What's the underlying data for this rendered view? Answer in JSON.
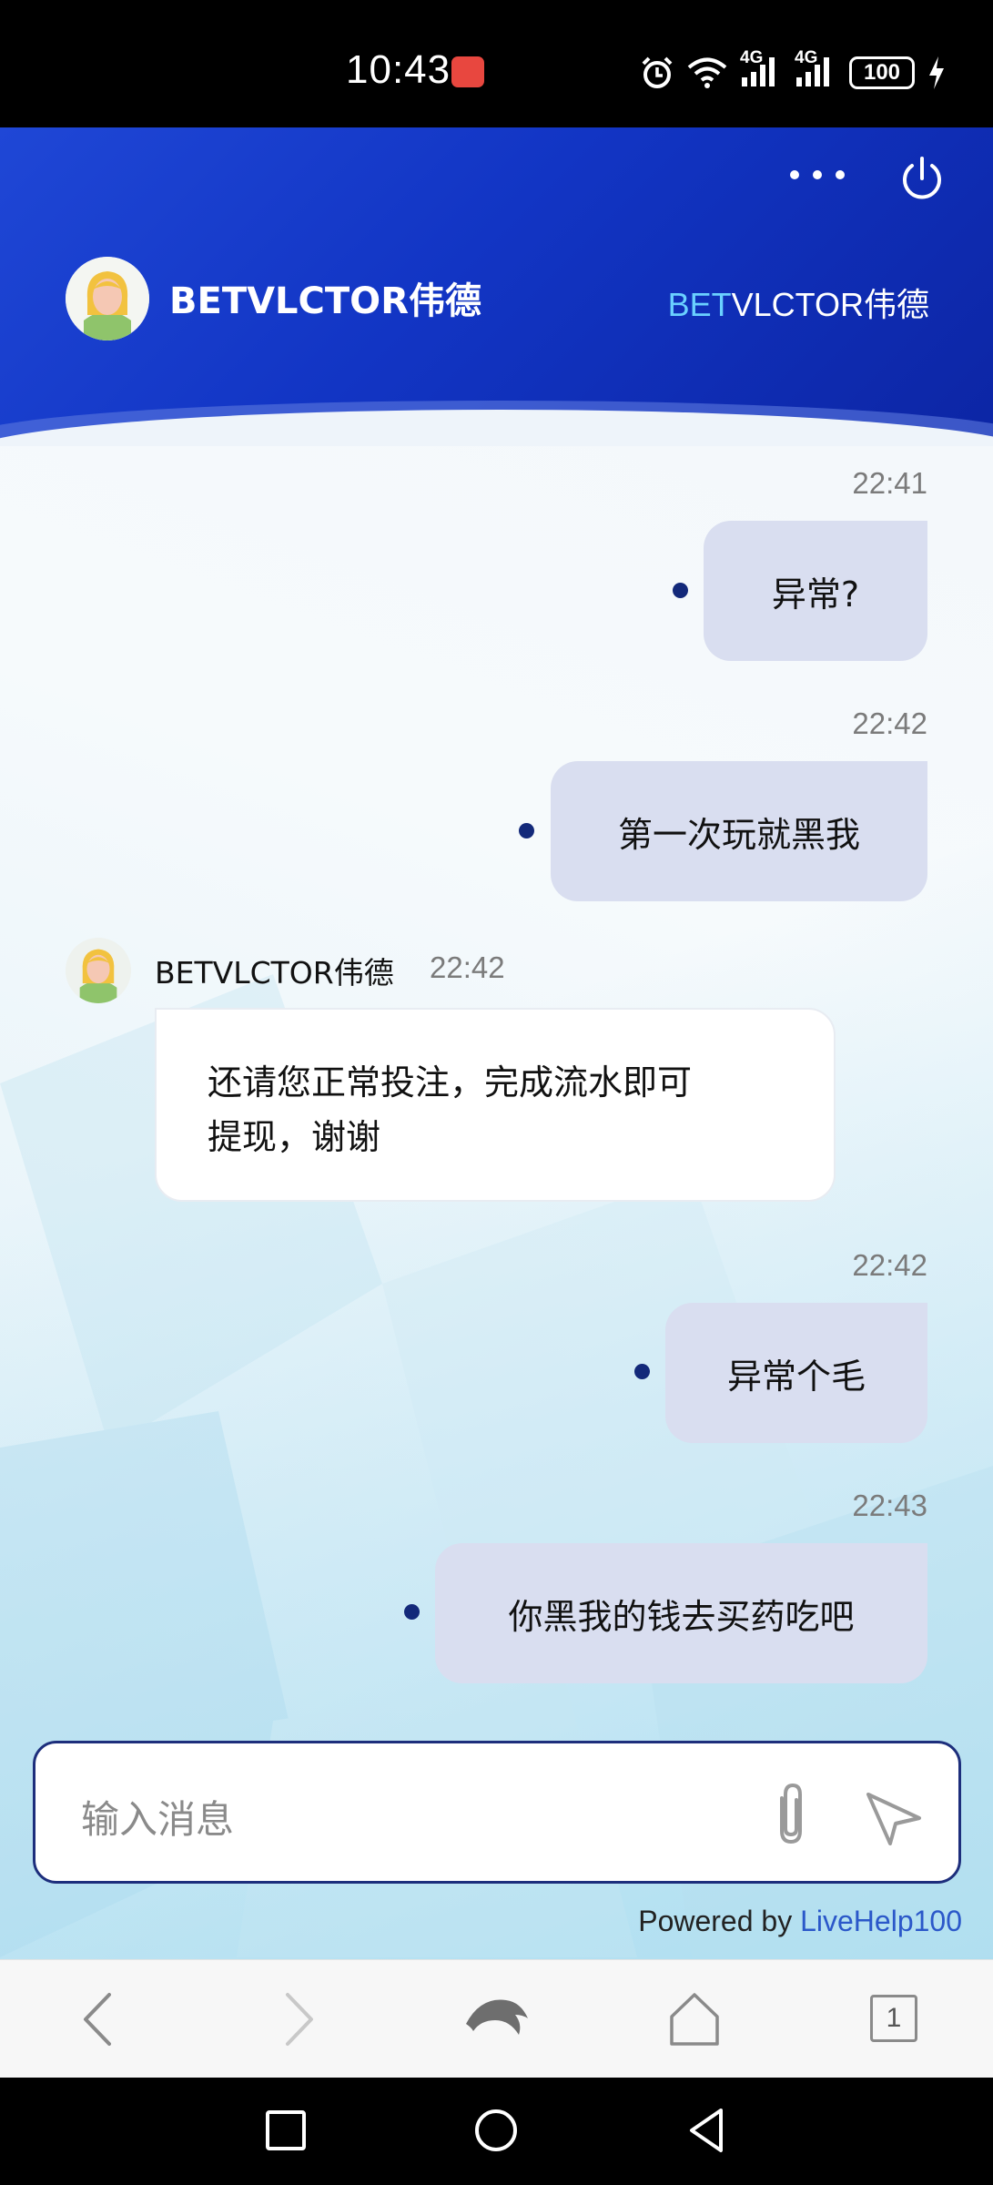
{
  "status_bar": {
    "time": "10:43",
    "network_1": "4G",
    "network_2": "4G",
    "battery": "100",
    "icons": [
      "huawei-app-icon",
      "alarm-icon",
      "wifi-icon",
      "signal-icon",
      "signal-icon",
      "battery-icon",
      "charging-icon"
    ]
  },
  "header": {
    "title": "BETVLCTOR伟德",
    "brand_logo_prefix": "BET",
    "brand_logo_suffix": "VLCTOR伟德",
    "icons": [
      "more-icon",
      "power-icon"
    ]
  },
  "messages": [
    {
      "sender": "user",
      "time": "22:41",
      "text": "异常?"
    },
    {
      "sender": "user",
      "time": "22:42",
      "text": "第一次玩就黑我"
    },
    {
      "sender": "agent",
      "name": "BETVLCTOR伟德",
      "time": "22:42",
      "lines": [
        "还请您正常投注，完成流水即可",
        "提现，谢谢"
      ]
    },
    {
      "sender": "user",
      "time": "22:42",
      "text": "异常个毛"
    },
    {
      "sender": "user",
      "time": "22:43",
      "text": "你黑我的钱去买药吃吧"
    }
  ],
  "composer": {
    "placeholder": "输入消息",
    "icons": [
      "attach-icon",
      "send-icon"
    ]
  },
  "footer": {
    "powered_prefix": "Powered by",
    "powered_link": "LiveHelp100"
  },
  "browser_nav": {
    "tab_count": "1",
    "icons": [
      "back-icon",
      "forward-icon",
      "dolphin-icon",
      "home-icon",
      "tabs-icon"
    ]
  },
  "system_nav": {
    "icons": [
      "recent-apps-icon",
      "home-circle-icon",
      "back-triangle-icon"
    ]
  },
  "colors": {
    "header_blue": "#1235c4",
    "user_bubble": "#d9def0",
    "dot": "#13297a",
    "link": "#2b58c9"
  }
}
